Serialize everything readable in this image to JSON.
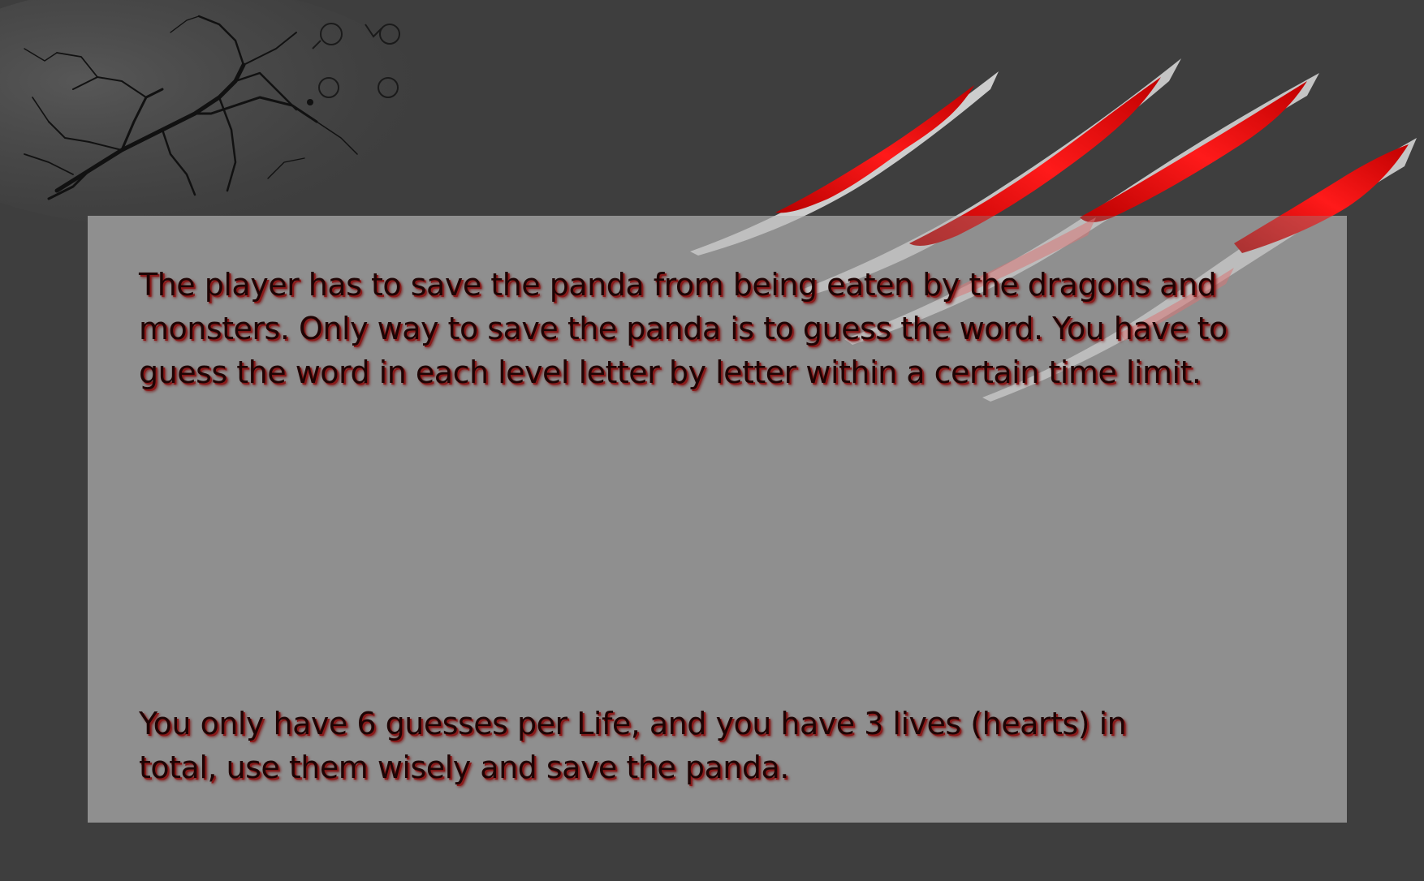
{
  "instructions": {
    "paragraph_1": "The player has to save the panda from being eaten by the dragons  and\nmonsters. Only way to save the panda is to guess the word. You have to\nguess the word in each level letter by letter within a certain time limit.",
    "paragraph_2": "You only have 6 guesses per Life, and you have 3 lives (hearts) in\ntotal, use them wisely and save the panda."
  },
  "colors": {
    "background": "#3e3e3e",
    "panel": "#8f8f8f",
    "text": "#1e0404",
    "text_glow": "#8a1a1a",
    "scratch_red": "#e60000",
    "scratch_white": "#e8e8e8"
  },
  "decorations": {
    "top_left": "cracked-ground-texture",
    "top_right": "claw-scratch-marks"
  }
}
